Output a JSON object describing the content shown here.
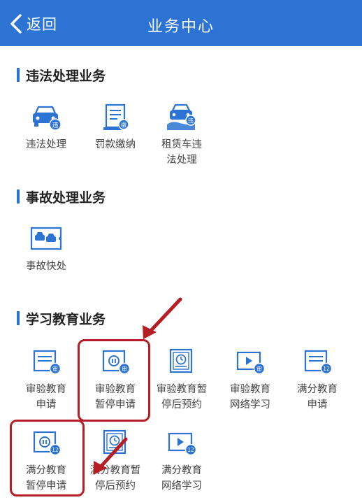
{
  "header": {
    "back_label": "返回",
    "title": "业务中心"
  },
  "sections": [
    {
      "title": "违法处理业务",
      "items": [
        {
          "label": "违法处理",
          "icon": "car-violation-icon"
        },
        {
          "label": "罚款缴纳",
          "icon": "fine-document-icon"
        },
        {
          "label": "租赁车违\n法处理",
          "icon": "rental-car-violation-icon"
        }
      ]
    },
    {
      "title": "事故处理业务",
      "items": [
        {
          "label": "事故快处",
          "icon": "accident-cars-icon"
        }
      ]
    },
    {
      "title": "学习教育业务",
      "items": [
        {
          "label": "审验教育\n申请",
          "icon": "document-shen-badge-icon"
        },
        {
          "label": "审验教育\n暂停申请",
          "icon": "pause-shen-badge-icon"
        },
        {
          "label": "审验教育暂\n停后预约",
          "icon": "clock-document-icon"
        },
        {
          "label": "审验教育\n网络学习",
          "icon": "video-shen-badge-icon"
        },
        {
          "label": "满分教育\n申请",
          "icon": "document-12-badge-icon"
        },
        {
          "label": "满分教育\n暂停申请",
          "icon": "pause-12-badge-icon"
        },
        {
          "label": "满分教育暂\n停后预约",
          "icon": "clock-document-icon"
        },
        {
          "label": "满分教育\n网络学习",
          "icon": "video-12-badge-icon"
        }
      ]
    }
  ],
  "badges": {
    "shen": "审",
    "wei": "违",
    "fine": "缴",
    "twelve": "12"
  },
  "colors": {
    "brand_blue": "#2c73d3",
    "highlight_red": "#b51e24"
  }
}
